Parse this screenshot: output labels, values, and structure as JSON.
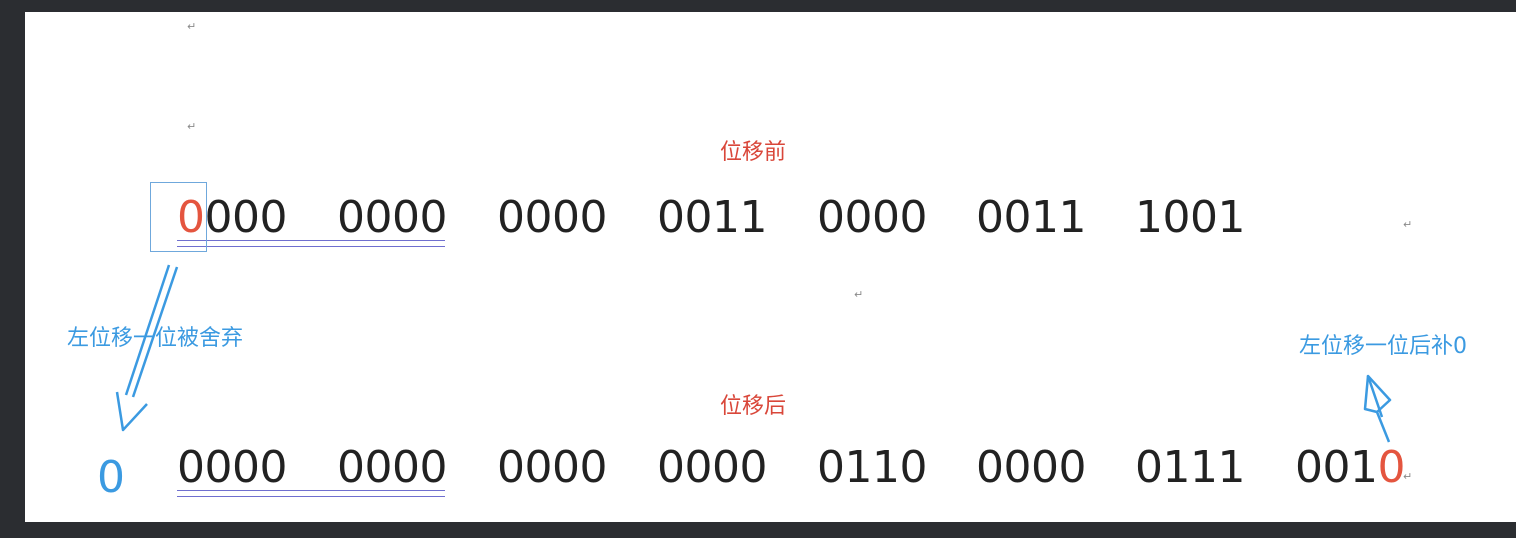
{
  "colors": {
    "accent_red": "#e4553f",
    "accent_blue": "#3b9ae1",
    "text": "#222222"
  },
  "labels": {
    "before": "位移前",
    "after": "位移后",
    "discard_note": "左位移一位被舍弃",
    "pad_note": "左位移一位后补0"
  },
  "before_bits": {
    "first_bit": "0",
    "first_rest": "000",
    "groups": [
      "0000",
      "0000",
      "0000",
      "0011",
      "0000",
      "0011",
      "1001"
    ]
  },
  "after_bits": {
    "dropped_bit": "0",
    "groups": [
      "0000",
      "0000",
      "0000",
      "0000",
      "0110",
      "0000",
      "0111"
    ],
    "last_prefix": "001",
    "last_bit": "0"
  },
  "icons": [
    "paragraph-mark-icon",
    "arrow-down-left-icon",
    "arrow-up-icon"
  ]
}
